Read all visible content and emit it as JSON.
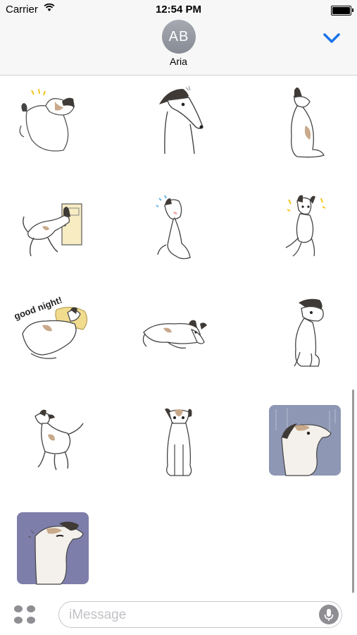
{
  "status_bar": {
    "carrier": "Carrier",
    "time": "12:54 PM"
  },
  "header": {
    "avatar_initials": "AB",
    "contact_name": "Aria"
  },
  "stickers": [
    {
      "name": "sticker-dog-dizzy"
    },
    {
      "name": "sticker-dog-surprised"
    },
    {
      "name": "sticker-dog-sitting-back"
    },
    {
      "name": "sticker-dog-at-door"
    },
    {
      "name": "sticker-dog-crying"
    },
    {
      "name": "sticker-dog-rolling"
    },
    {
      "name": "sticker-dog-good-night",
      "text": "good night!"
    },
    {
      "name": "sticker-dog-lying-down"
    },
    {
      "name": "sticker-dog-sitting-tilted"
    },
    {
      "name": "sticker-dog-walking"
    },
    {
      "name": "sticker-dog-sitting-front"
    },
    {
      "name": "sticker-dog-rain-portrait"
    },
    {
      "name": "sticker-dog-gloomy-portrait"
    }
  ],
  "input": {
    "placeholder": "iMessage"
  },
  "colors": {
    "accent": "#1a73e8",
    "gloomy_bg": "#7e7eab",
    "blanket": "#f1dc8e"
  }
}
